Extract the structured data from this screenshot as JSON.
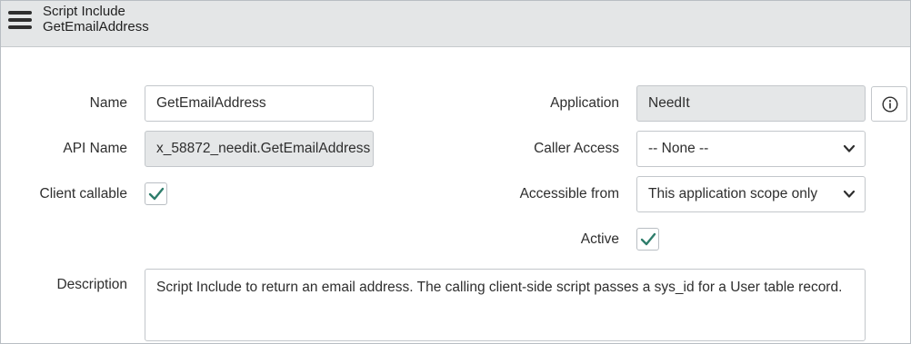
{
  "header": {
    "record_type": "Script Include",
    "record_name": "GetEmailAddress",
    "menu_icon": "hamburger-menu-icon"
  },
  "form": {
    "name": {
      "label": "Name",
      "value": "GetEmailAddress"
    },
    "api_name": {
      "label": "API Name",
      "value": "x_58872_needit.GetEmailAddress"
    },
    "client_callable": {
      "label": "Client callable",
      "checked": true
    },
    "application": {
      "label": "Application",
      "value": "NeedIt",
      "info_icon": "info-icon"
    },
    "caller_access": {
      "label": "Caller Access",
      "value": "-- None --"
    },
    "accessible_from": {
      "label": "Accessible from",
      "value": "This application scope only"
    },
    "active": {
      "label": "Active",
      "checked": true
    },
    "description": {
      "label": "Description",
      "value": "Script Include to return an email address.  The calling client-side script passes a sys_id for a User table record."
    }
  },
  "colors": {
    "header_bg": "#e4e6e7",
    "readonly_bg": "#e5e7e8",
    "checkmark": "#2e7d6b",
    "border": "#c3c7cb"
  }
}
